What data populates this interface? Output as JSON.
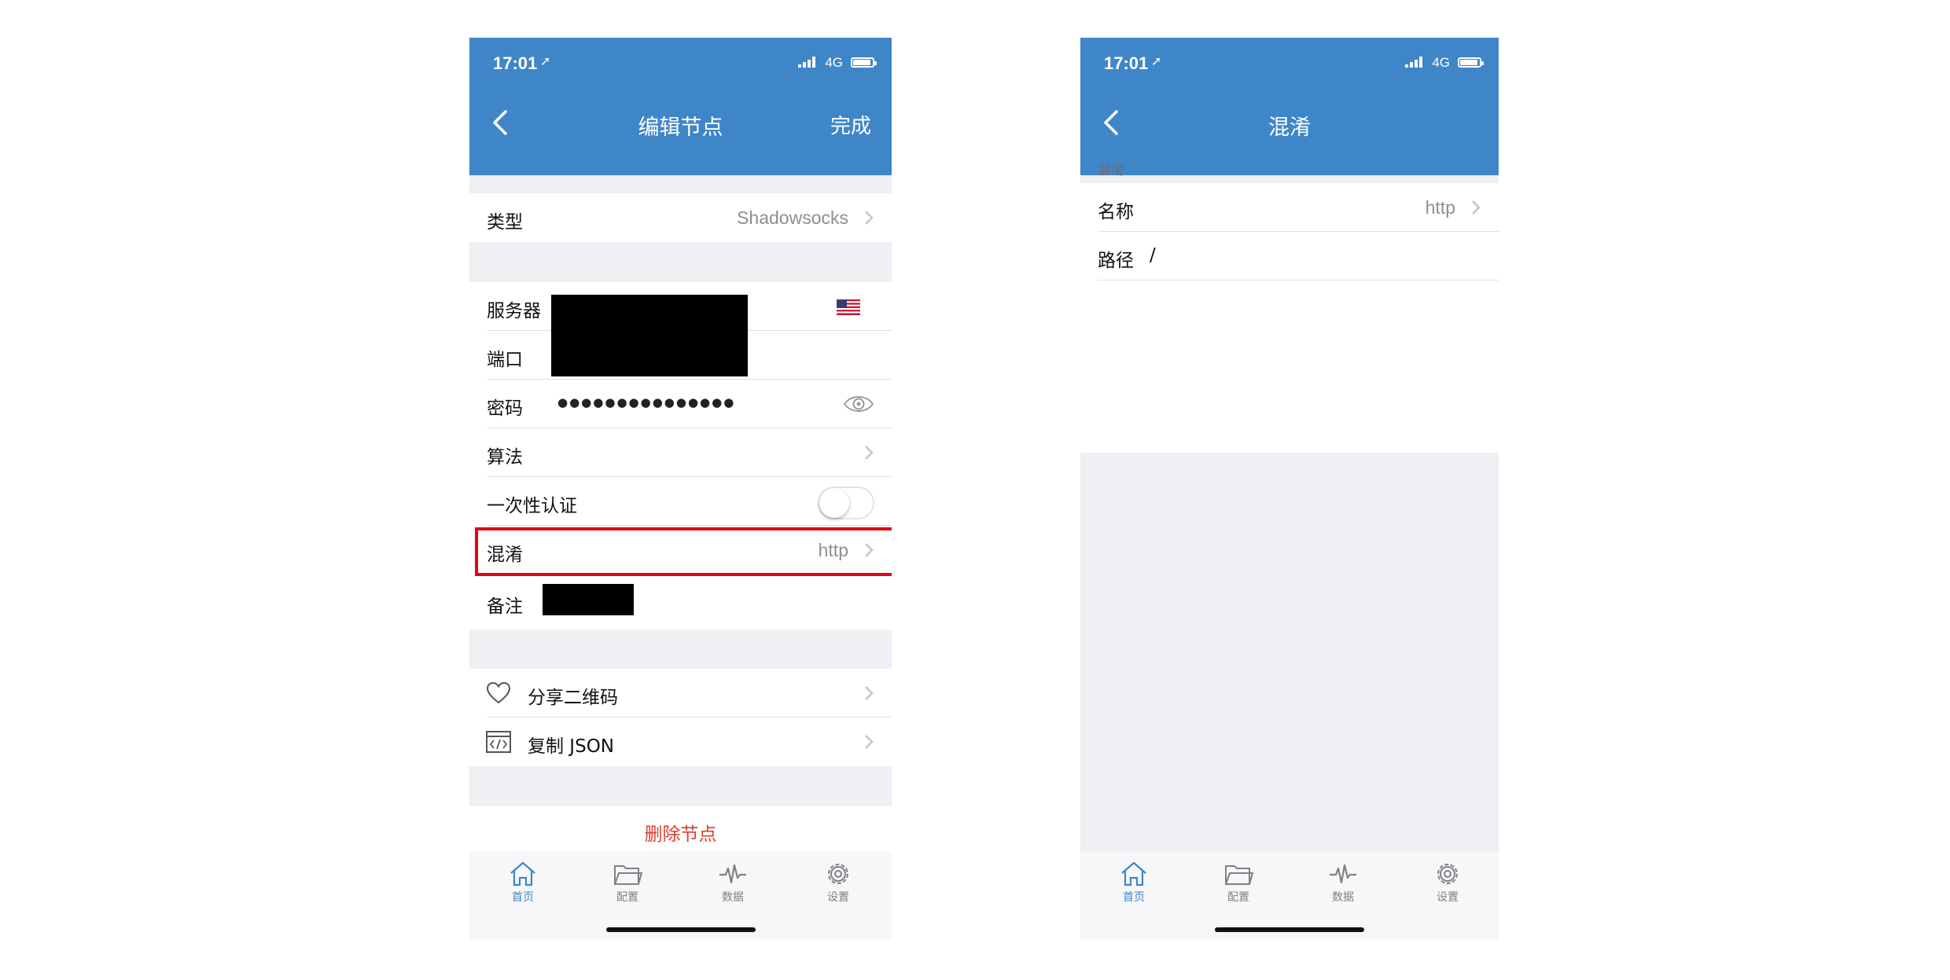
{
  "colors": {
    "nav_blue": "#3f86c8",
    "destructive_red": "#e23b2d",
    "highlight_red": "#e30613",
    "secondary_gray": "#8e8e93"
  },
  "status": {
    "time": "17:01",
    "network": "4G"
  },
  "left": {
    "nav": {
      "title": "编辑节点",
      "done": "完成"
    },
    "type_row": {
      "label": "类型",
      "value": "Shadowsocks"
    },
    "server": {
      "label": "服务器",
      "flag_icon": "us-flag-icon"
    },
    "port": {
      "label": "端口"
    },
    "password": {
      "label": "密码",
      "value": "●●●●●●●●●●●●●●●"
    },
    "cipher": {
      "label": "算法"
    },
    "ota": {
      "label": "一次性认证",
      "enabled": false
    },
    "obfs": {
      "label": "混淆",
      "value": "http"
    },
    "remark": {
      "label": "备注"
    },
    "share": {
      "label": "分享二维码",
      "icon": "heart-icon"
    },
    "copy_json": {
      "label": "复制 JSON",
      "icon": "code-icon"
    },
    "delete": {
      "label": "删除节点"
    }
  },
  "right": {
    "nav": {
      "title": "混淆"
    },
    "section_header": "混淆",
    "name": {
      "label": "名称",
      "value": "http"
    },
    "path": {
      "label": "路径",
      "value": "/"
    }
  },
  "tabs": [
    {
      "label": "首页",
      "icon": "home-icon",
      "active": true
    },
    {
      "label": "配置",
      "icon": "folder-icon",
      "active": false
    },
    {
      "label": "数据",
      "icon": "pulse-icon",
      "active": false
    },
    {
      "label": "设置",
      "icon": "gear-icon",
      "active": false
    }
  ]
}
